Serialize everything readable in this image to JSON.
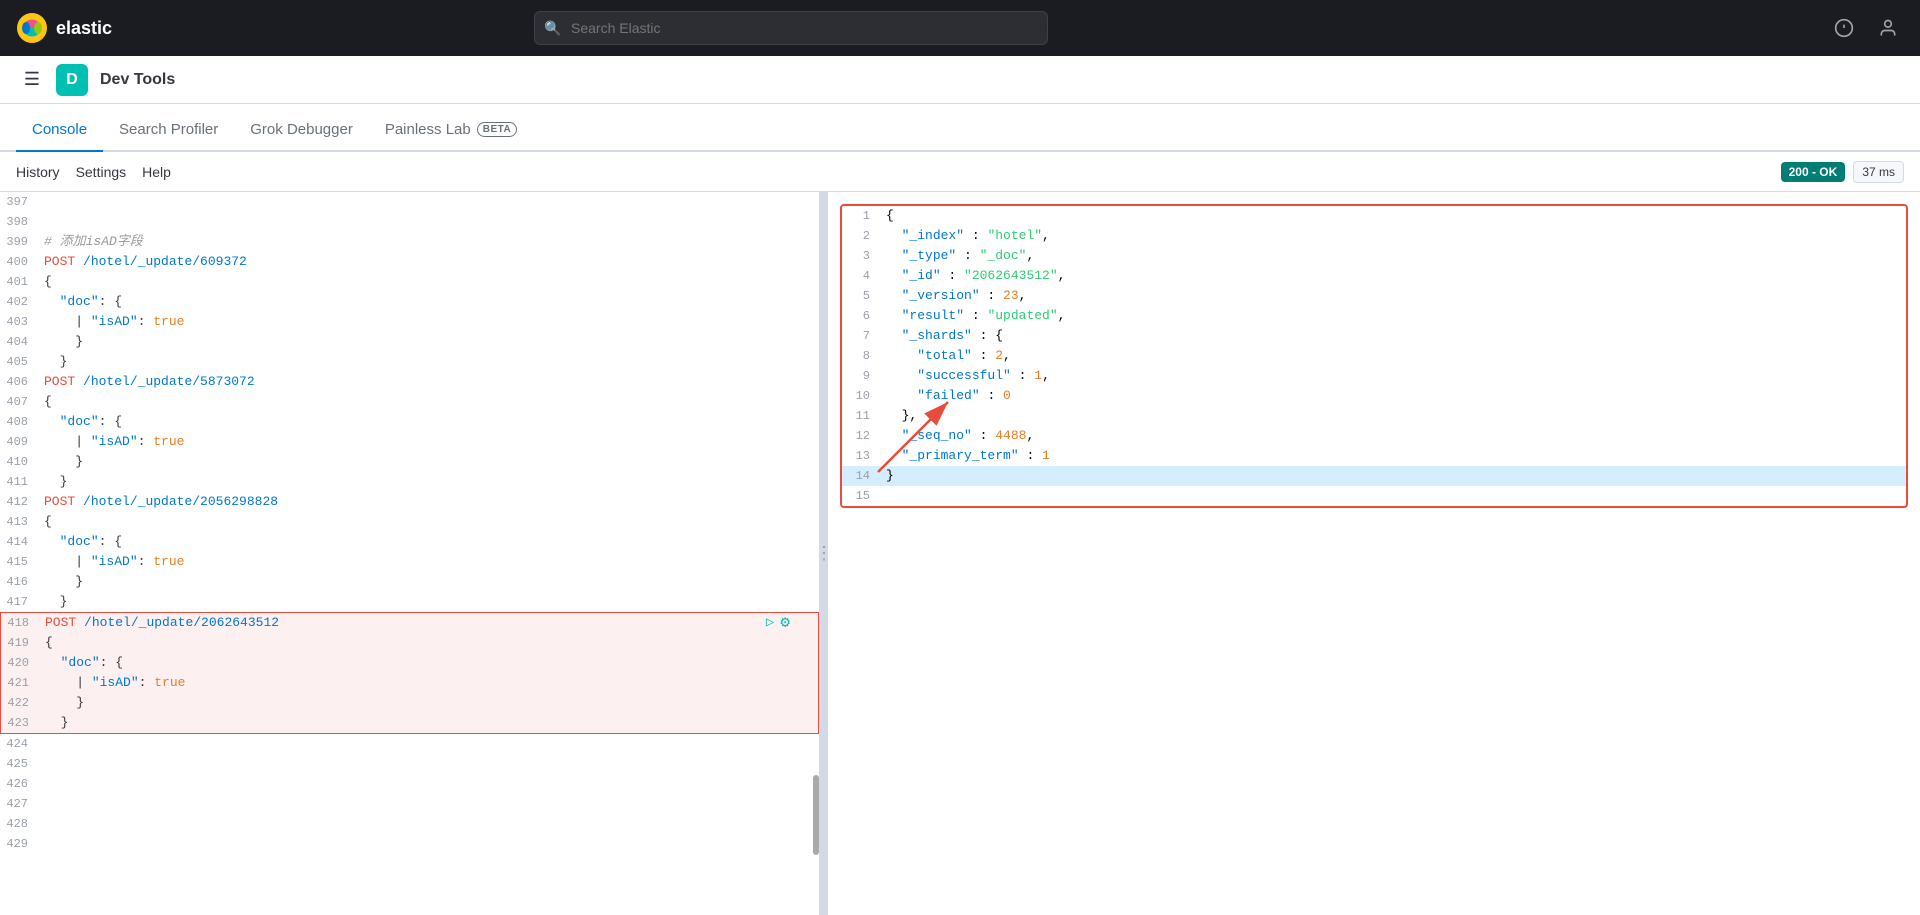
{
  "topNav": {
    "logoText": "elastic",
    "searchPlaceholder": "Search Elastic",
    "icons": [
      "news-icon",
      "user-icon"
    ]
  },
  "secondaryNav": {
    "appBadgeLabel": "D",
    "appTitle": "Dev Tools"
  },
  "tabs": [
    {
      "id": "console",
      "label": "Console",
      "active": true
    },
    {
      "id": "search-profiler",
      "label": "Search Profiler",
      "active": false
    },
    {
      "id": "grok-debugger",
      "label": "Grok Debugger",
      "active": false
    },
    {
      "id": "painless-lab",
      "label": "Painless Lab",
      "active": false,
      "badge": "BETA"
    }
  ],
  "toolbar": {
    "historyLabel": "History",
    "settingsLabel": "Settings",
    "helpLabel": "Help",
    "statusCode": "200 - OK",
    "responseTime": "37 ms"
  },
  "editor": {
    "lines": [
      {
        "num": "397",
        "content": ""
      },
      {
        "num": "398",
        "content": ""
      },
      {
        "num": "399",
        "content": "# 添加isAD字段",
        "type": "comment"
      },
      {
        "num": "400",
        "content": "POST /hotel/_update/609372",
        "type": "request"
      },
      {
        "num": "401",
        "content": "{",
        "type": "brace"
      },
      {
        "num": "402",
        "content": "  \"doc\": {",
        "type": "obj"
      },
      {
        "num": "403",
        "content": "    | \"isAD\": true",
        "type": "field"
      },
      {
        "num": "404",
        "content": "    }",
        "type": "brace"
      },
      {
        "num": "405",
        "content": "  }",
        "type": "brace"
      },
      {
        "num": "406",
        "content": "POST /hotel/_update/5873072",
        "type": "request"
      },
      {
        "num": "407",
        "content": "{",
        "type": "brace"
      },
      {
        "num": "408",
        "content": "  \"doc\": {",
        "type": "obj"
      },
      {
        "num": "409",
        "content": "    | \"isAD\": true",
        "type": "field"
      },
      {
        "num": "410",
        "content": "    }",
        "type": "brace"
      },
      {
        "num": "411",
        "content": "  }",
        "type": "brace"
      },
      {
        "num": "412",
        "content": "POST /hotel/_update/2056298828",
        "type": "request"
      },
      {
        "num": "413",
        "content": "{",
        "type": "brace"
      },
      {
        "num": "414",
        "content": "  \"doc\": {",
        "type": "obj"
      },
      {
        "num": "415",
        "content": "    | \"isAD\": true",
        "type": "field"
      },
      {
        "num": "416",
        "content": "    }",
        "type": "brace"
      },
      {
        "num": "417",
        "content": "  }",
        "type": "brace"
      },
      {
        "num": "418",
        "content": "POST /hotel/_update/2062643512",
        "type": "request",
        "active": true
      },
      {
        "num": "419",
        "content": "{",
        "type": "brace",
        "active": true
      },
      {
        "num": "420",
        "content": "  \"doc\": {",
        "type": "obj",
        "active": true
      },
      {
        "num": "421",
        "content": "    | \"isAD\": true",
        "type": "field",
        "active": true
      },
      {
        "num": "422",
        "content": "    }",
        "type": "brace",
        "active": true
      },
      {
        "num": "423",
        "content": "  }",
        "type": "brace",
        "active": true
      },
      {
        "num": "424",
        "content": ""
      },
      {
        "num": "425",
        "content": ""
      },
      {
        "num": "426",
        "content": ""
      },
      {
        "num": "427",
        "content": ""
      },
      {
        "num": "428",
        "content": ""
      },
      {
        "num": "429",
        "content": ""
      }
    ]
  },
  "response": {
    "lines": [
      {
        "num": "1",
        "content": "{"
      },
      {
        "num": "2",
        "content": "  \"_index\" : \"hotel\","
      },
      {
        "num": "3",
        "content": "  \"_type\" : \"_doc\","
      },
      {
        "num": "4",
        "content": "  \"_id\" : \"2062643512\","
      },
      {
        "num": "5",
        "content": "  \"_version\" : 23,"
      },
      {
        "num": "6",
        "content": "  \"result\" : \"updated\","
      },
      {
        "num": "7",
        "content": "  \"_shards\" : {"
      },
      {
        "num": "8",
        "content": "    \"total\" : 2,"
      },
      {
        "num": "9",
        "content": "    \"successful\" : 1,"
      },
      {
        "num": "10",
        "content": "    \"failed\" : 0"
      },
      {
        "num": "11",
        "content": "  },"
      },
      {
        "num": "12",
        "content": "  \"_seq_no\" : 4488,"
      },
      {
        "num": "13",
        "content": "  \"_primary_term\" : 1"
      },
      {
        "num": "14",
        "content": "}",
        "selected": true
      },
      {
        "num": "15",
        "content": ""
      }
    ]
  }
}
